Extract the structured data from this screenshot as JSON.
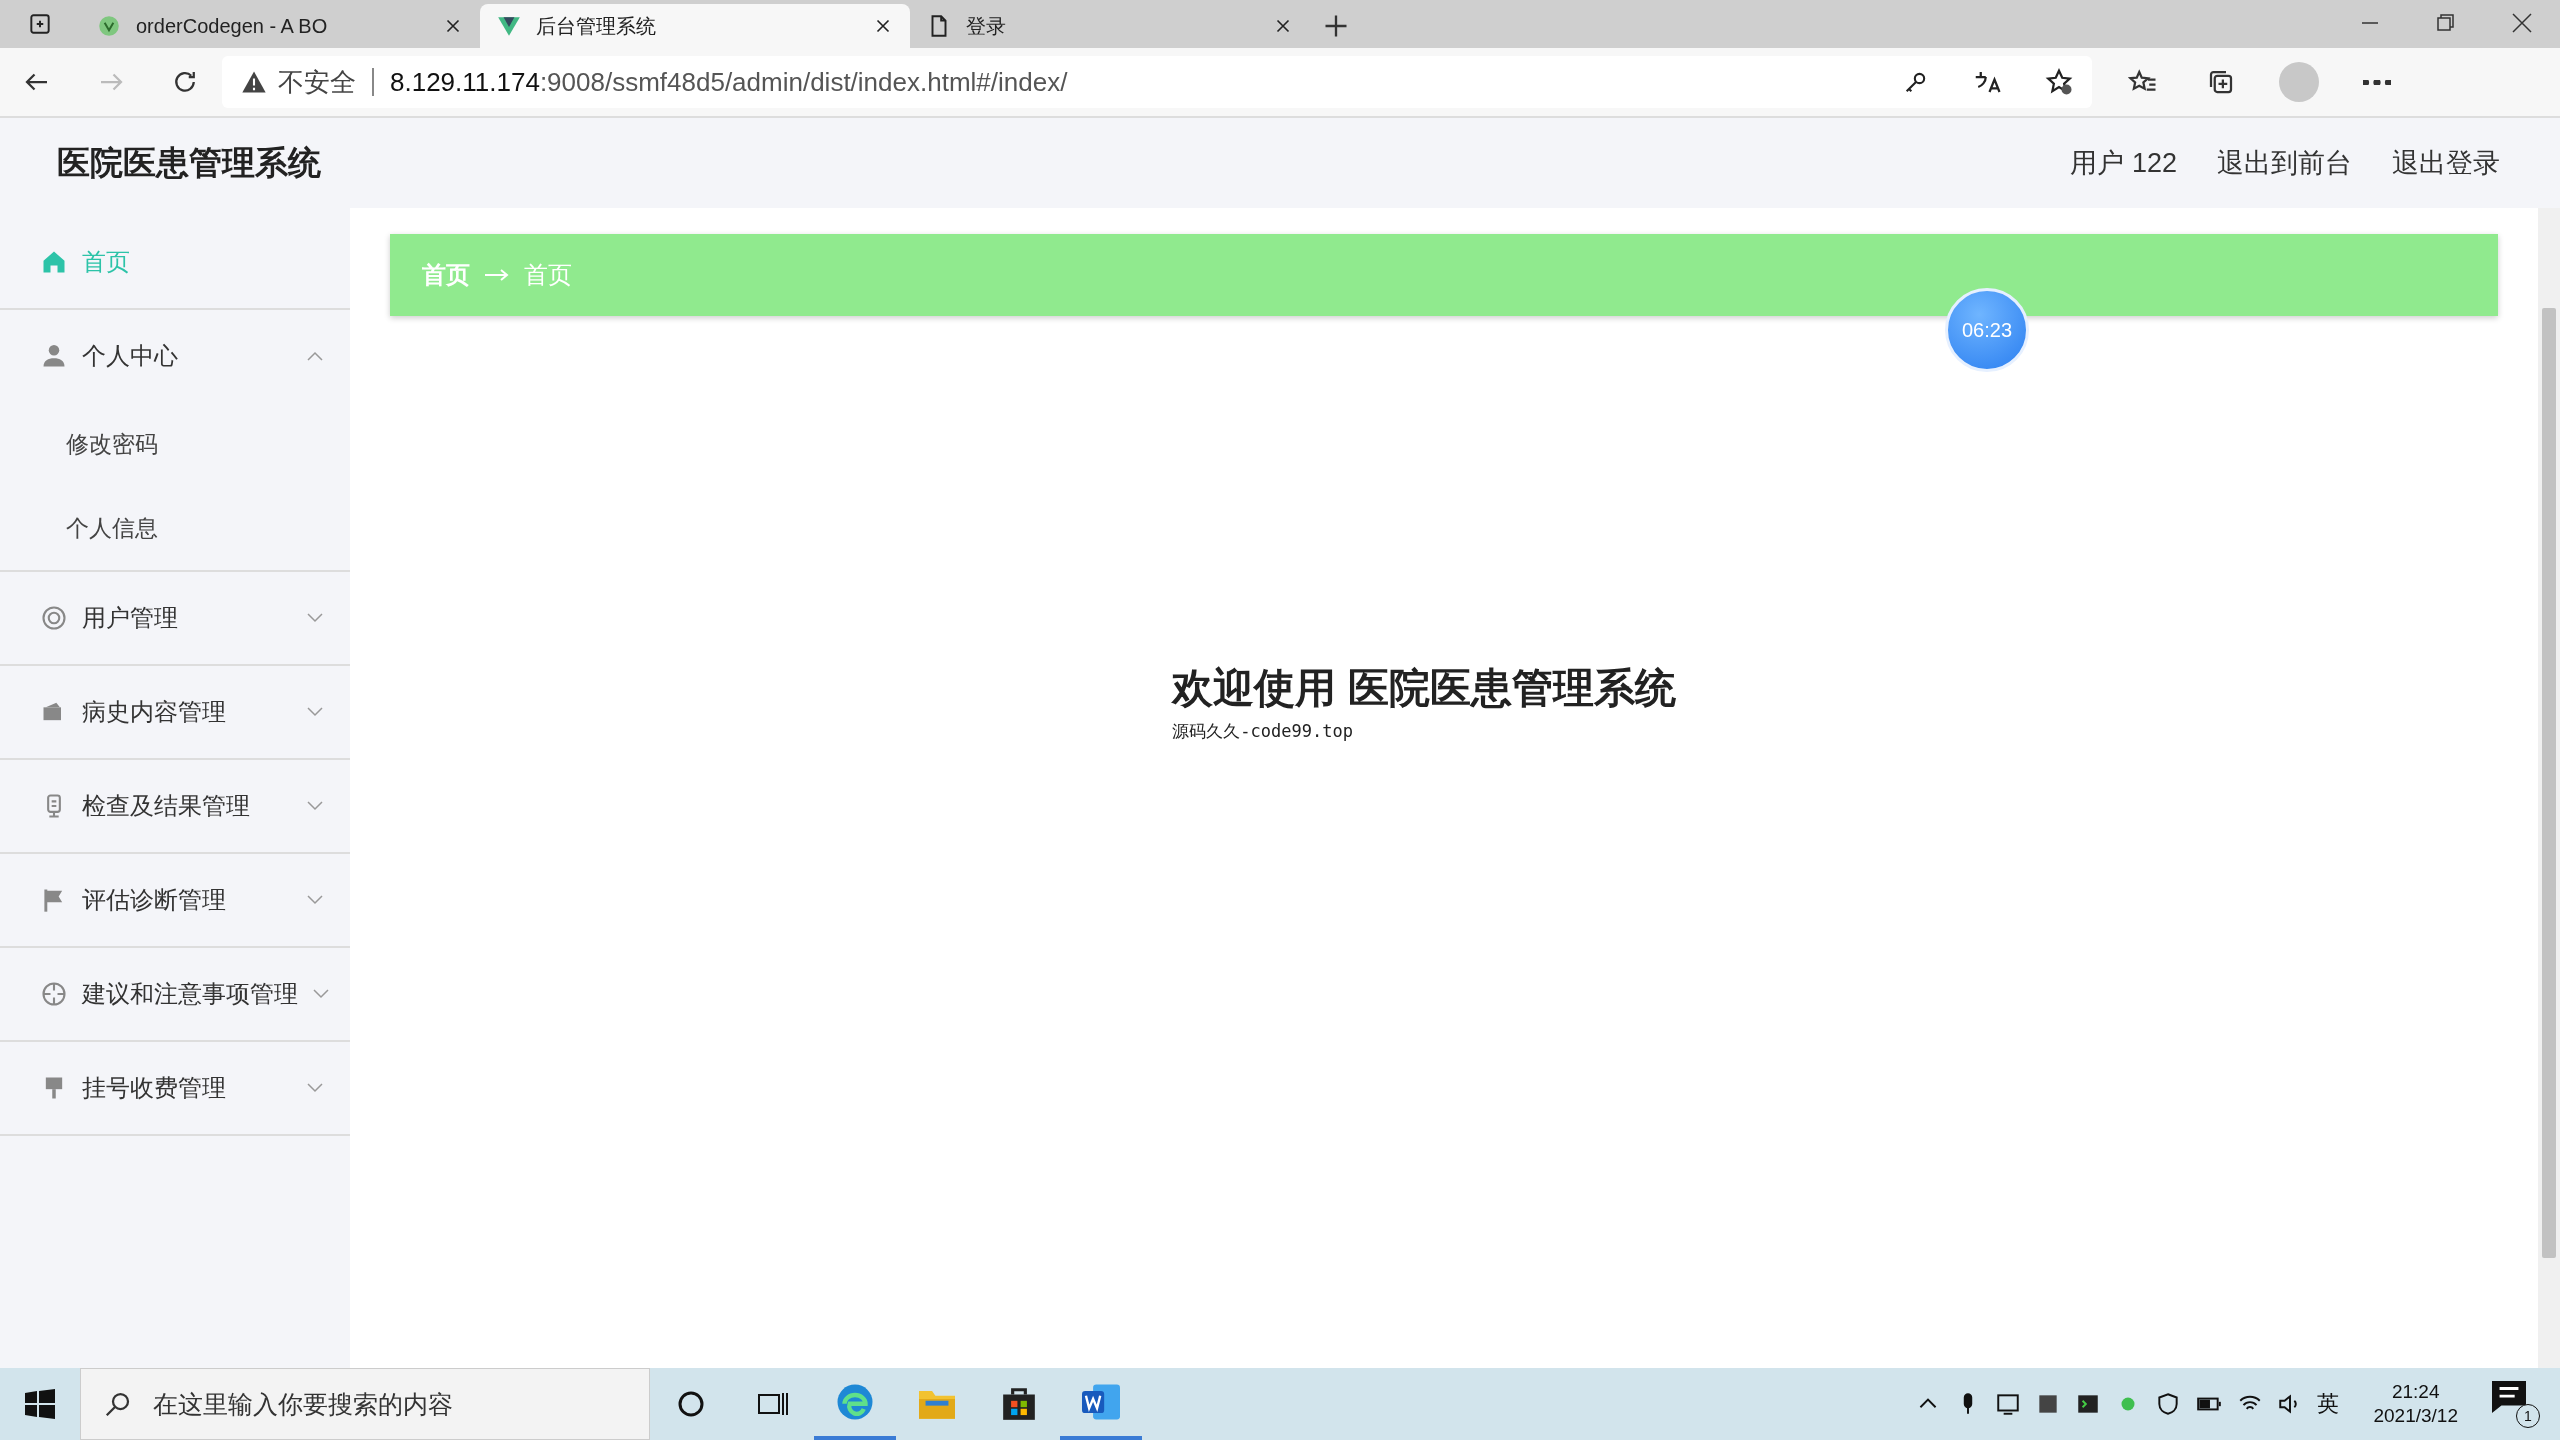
{
  "browser": {
    "tabs": [
      {
        "title": "orderCodegen - A BO",
        "selected": false
      },
      {
        "title": "后台管理系统",
        "selected": true
      },
      {
        "title": "登录",
        "selected": false
      }
    ],
    "address": {
      "warning": "不安全",
      "host": "8.129.11.174",
      "path": ":9008/ssmf48d5/admin/dist/index.html#/index/"
    }
  },
  "app": {
    "title": "医院医患管理系统",
    "header_links": [
      "用户 122",
      "退出到前台",
      "退出登录"
    ],
    "sidebar": {
      "items": [
        {
          "label": "首页",
          "selected": true
        },
        {
          "label": "个人中心",
          "selected": false,
          "expanded": true,
          "children": [
            {
              "label": "修改密码"
            },
            {
              "label": "个人信息"
            }
          ]
        },
        {
          "label": "用户管理",
          "selected": false,
          "expanded": false
        },
        {
          "label": "病史内容管理",
          "selected": false,
          "expanded": false
        },
        {
          "label": "检查及结果管理",
          "selected": false,
          "expanded": false
        },
        {
          "label": "评估诊断管理",
          "selected": false,
          "expanded": false
        },
        {
          "label": "建议和注意事项管理",
          "selected": false,
          "expanded": false
        },
        {
          "label": "挂号收费管理",
          "selected": false,
          "expanded": false
        }
      ]
    },
    "breadcrumb": [
      "首页",
      "首页"
    ],
    "timer": "06:23",
    "welcome": {
      "title": "欢迎使用 医院医患管理系统",
      "subtitle": "源码久久-code99.top"
    }
  },
  "taskbar": {
    "search_placeholder": "在这里输入你要搜索的内容",
    "ime": "英",
    "time": "21:24",
    "date": "2021/3/12",
    "notifications": "1"
  }
}
